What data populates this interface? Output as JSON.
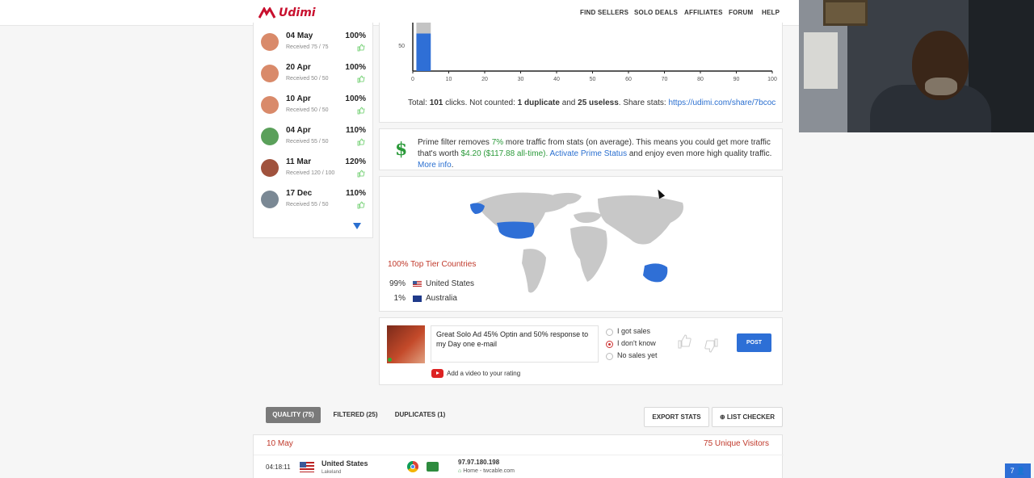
{
  "nav": {
    "logo": "Udimi",
    "items": [
      "FIND SELLERS",
      "SOLO DEALS",
      "AFFILIATES",
      "FORUM",
      "HELP"
    ]
  },
  "sidebar": {
    "items": [
      {
        "date": "04 May",
        "received": "Received 75 / 75",
        "percent": "100%",
        "avatar_color": "#d98a6a"
      },
      {
        "date": "20 Apr",
        "received": "Received 50 / 50",
        "percent": "100%",
        "avatar_color": "#d98a6a"
      },
      {
        "date": "10 Apr",
        "received": "Received 50 / 50",
        "percent": "100%",
        "avatar_color": "#d98a6a"
      },
      {
        "date": "04 Apr",
        "received": "Received 55 / 50",
        "percent": "110%",
        "avatar_color": "#5aa05a"
      },
      {
        "date": "11 Mar",
        "received": "Received 120 / 100",
        "percent": "120%",
        "avatar_color": "#a0523d"
      },
      {
        "date": "17 Dec",
        "received": "Received 55 / 50",
        "percent": "110%",
        "avatar_color": "#7a8894"
      }
    ]
  },
  "chart_data": {
    "type": "bar",
    "y_tick_labels": [
      "50"
    ],
    "x_tick_labels": [
      "0",
      "10",
      "20",
      "30",
      "40",
      "50",
      "60",
      "70",
      "80",
      "90",
      "100"
    ],
    "xlim": [
      0,
      100
    ],
    "bars": [
      {
        "x_start": 1,
        "x_end": 5,
        "value": 75,
        "duplicate_and_useless": 26
      }
    ],
    "grid": false
  },
  "totals": {
    "prefix": "Total:",
    "total": "101",
    "clicks": "clicks. Not counted:",
    "duplicate": "1 duplicate",
    "and": "and",
    "useless": "25 useless",
    "share": ". Share stats:",
    "share_url": "https://udimi.com/share/7bcoc"
  },
  "prime": {
    "dollar": "$",
    "t1": "Prime filter removes",
    "pct": "7%",
    "t2": "more traffic from stats (on average). This means you could get more traffic that's",
    "t3": "worth",
    "worth": "$4.20 ($117.88 all-time).",
    "activate": "Activate Prime Status",
    "t4": "and enjoy even more high quality traffic.",
    "more": "More info",
    "dot": "."
  },
  "map": {
    "tier": "100% Top Tier Countries",
    "countries": [
      {
        "pct": "99%",
        "name": "United States"
      },
      {
        "pct": "1%",
        "name": "Australia"
      }
    ],
    "colors": {
      "land": "#c8c8c8",
      "highlight": "#2f6fd6"
    }
  },
  "rating": {
    "comment": "Great Solo Ad 45% Optin and 50% response to my Day one e-mail",
    "options": [
      "I got sales",
      "I don't know",
      "No sales yet"
    ],
    "selected": 1,
    "post": "POST",
    "video": "Add a video to your rating"
  },
  "tabs": {
    "quality": "QUALITY (75)",
    "filtered": "FILTERED (25)",
    "duplicates": "DUPLICATES (1)",
    "export": "EXPORT STATS",
    "list_checker": "LIST CHECKER"
  },
  "stats": {
    "date": "10 May",
    "unique": "75 Unique Visitors",
    "row": {
      "time": "04:18:11",
      "country": "United States",
      "city": "Lakeland",
      "ip": "97.97.180.198",
      "home": "Home",
      "host": "- twcable.com"
    }
  },
  "chat_badge": "7"
}
